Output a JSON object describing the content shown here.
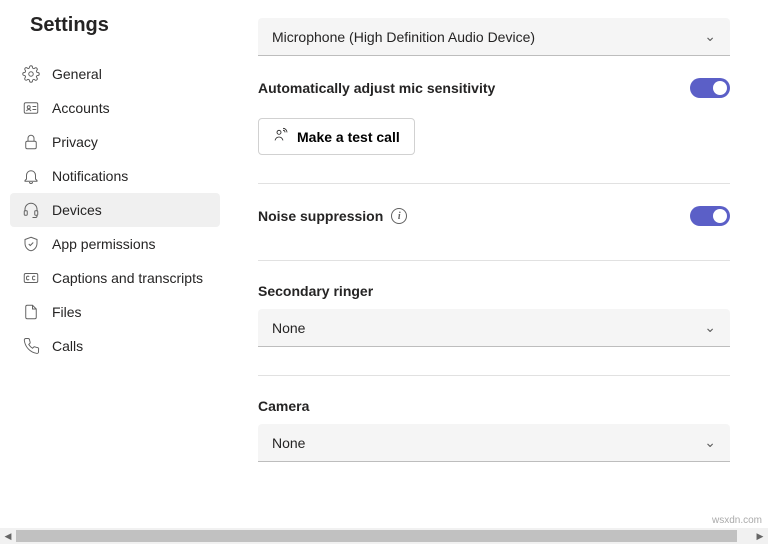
{
  "header": {
    "title": "Settings"
  },
  "sidebar": {
    "items": [
      {
        "label": "General"
      },
      {
        "label": "Accounts"
      },
      {
        "label": "Privacy"
      },
      {
        "label": "Notifications"
      },
      {
        "label": "Devices"
      },
      {
        "label": "App permissions"
      },
      {
        "label": "Captions and transcripts"
      },
      {
        "label": "Files"
      },
      {
        "label": "Calls"
      }
    ]
  },
  "main": {
    "microphone": {
      "value": "Microphone (High Definition Audio Device)"
    },
    "auto_mic": {
      "label": "Automatically adjust mic sensitivity"
    },
    "test_call": {
      "label": "Make a test call"
    },
    "noise": {
      "label": "Noise suppression"
    },
    "ringer": {
      "label": "Secondary ringer",
      "value": "None"
    },
    "camera": {
      "label": "Camera",
      "value": "None"
    }
  },
  "watermark": "wsxdn.com"
}
